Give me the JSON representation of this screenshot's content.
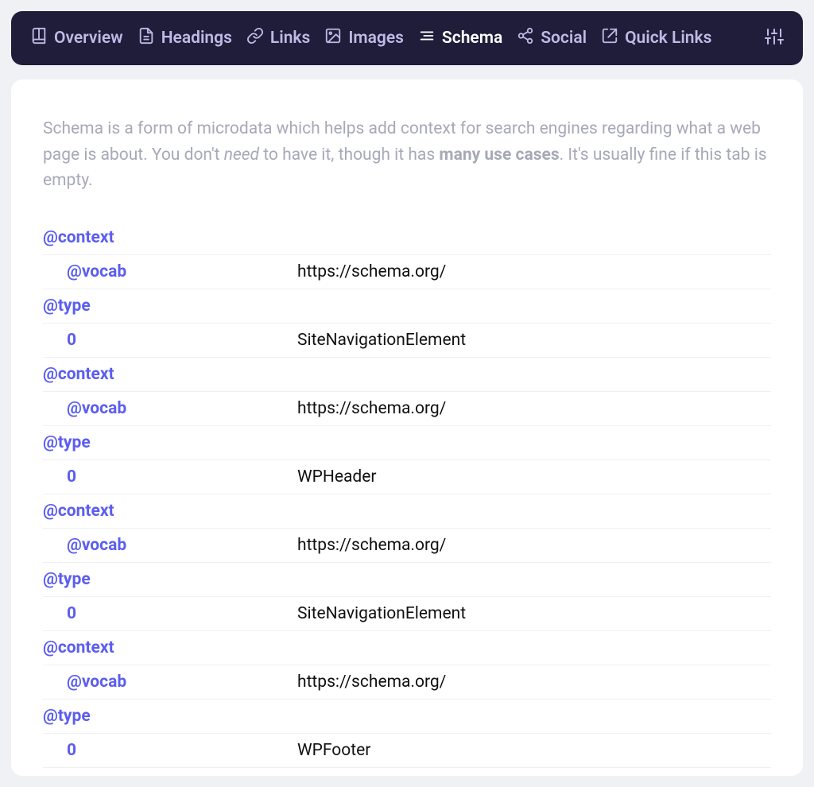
{
  "tabs": {
    "overview": "Overview",
    "headings": "Headings",
    "links": "Links",
    "images": "Images",
    "schema": "Schema",
    "social": "Social",
    "quicklinks": "Quick Links"
  },
  "intro": {
    "p1": "Schema is a form of microdata which helps add context for search engines regarding what a web page is about. You don't ",
    "em": "need",
    "p2": " to have it, though it has ",
    "b": "many use cases",
    "p3": ". It's usually fine if this tab is empty."
  },
  "schema_rows": [
    {
      "key": "@context",
      "indent": false,
      "val": ""
    },
    {
      "key": "@vocab",
      "indent": true,
      "val": "https://schema.org/"
    },
    {
      "key": "@type",
      "indent": false,
      "val": ""
    },
    {
      "key": "0",
      "indent": true,
      "val": "SiteNavigationElement"
    },
    {
      "key": "@context",
      "indent": false,
      "val": ""
    },
    {
      "key": "@vocab",
      "indent": true,
      "val": "https://schema.org/"
    },
    {
      "key": "@type",
      "indent": false,
      "val": ""
    },
    {
      "key": "0",
      "indent": true,
      "val": "WPHeader"
    },
    {
      "key": "@context",
      "indent": false,
      "val": ""
    },
    {
      "key": "@vocab",
      "indent": true,
      "val": "https://schema.org/"
    },
    {
      "key": "@type",
      "indent": false,
      "val": ""
    },
    {
      "key": "0",
      "indent": true,
      "val": "SiteNavigationElement"
    },
    {
      "key": "@context",
      "indent": false,
      "val": ""
    },
    {
      "key": "@vocab",
      "indent": true,
      "val": "https://schema.org/"
    },
    {
      "key": "@type",
      "indent": false,
      "val": ""
    },
    {
      "key": "0",
      "indent": true,
      "val": "WPFooter"
    }
  ]
}
